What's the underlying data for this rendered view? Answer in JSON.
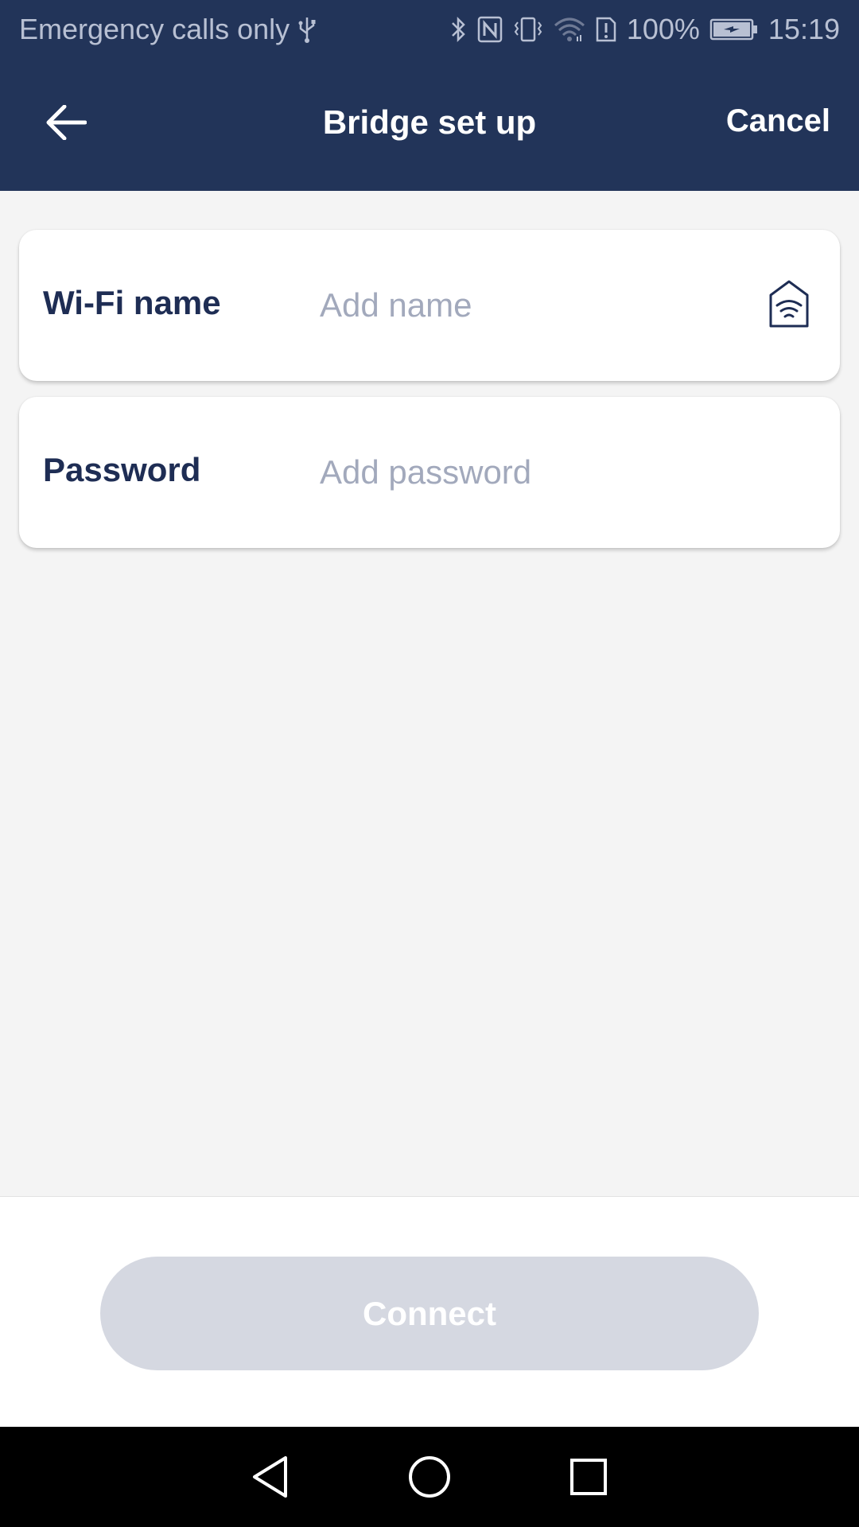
{
  "status_bar": {
    "carrier_text": "Emergency calls only",
    "battery_percent": "100%",
    "time": "15:19"
  },
  "app_bar": {
    "title": "Bridge set up",
    "cancel_label": "Cancel"
  },
  "form": {
    "wifi_name": {
      "label": "Wi-Fi name",
      "placeholder": "Add name",
      "value": ""
    },
    "password": {
      "label": "Password",
      "placeholder": "Add password",
      "value": ""
    }
  },
  "connect_button": {
    "label": "Connect",
    "enabled": false
  },
  "colors": {
    "header_bg": "#223459",
    "label_text": "#1e2d54",
    "placeholder_text": "#a2a9bc",
    "disabled_button_bg": "#d5d8e1",
    "page_bg": "#f4f4f4"
  },
  "icons": {
    "back": "arrow-left-icon",
    "wifi_bridge": "wifi-home-icon",
    "usb": "usb-icon",
    "bluetooth": "bluetooth-icon",
    "nfc": "nfc-icon",
    "vibrate": "vibrate-icon",
    "wifi": "wifi-icon",
    "sim_alert": "sim-alert-icon",
    "battery": "battery-charging-icon",
    "nav_back": "nav-back-icon",
    "nav_home": "nav-home-icon",
    "nav_recents": "nav-recents-icon"
  }
}
